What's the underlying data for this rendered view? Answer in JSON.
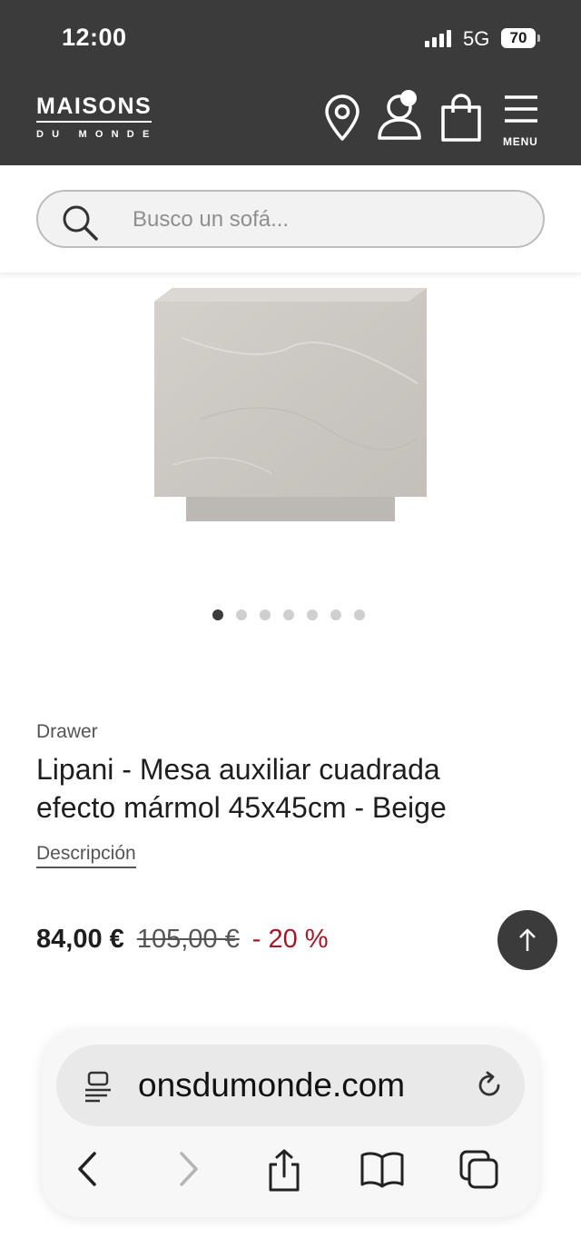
{
  "status_bar": {
    "time": "12:00",
    "network": "5G",
    "battery": "70"
  },
  "header": {
    "logo_main": "MAISONS",
    "logo_sub": "DU MONDE",
    "menu_label": "MENU",
    "bg_color": "#3b3b3b"
  },
  "search": {
    "placeholder": "Busco un sofá..."
  },
  "gallery": {
    "dot_count": 7,
    "active_index": 0
  },
  "product": {
    "brand": "Drawer",
    "title": "Lipani - Mesa auxiliar cuadrada efecto mármol 45x45cm - Beige",
    "description_link": "Descripción",
    "price_current": "84,00 €",
    "price_original": "105,00 €",
    "discount": "- 20 %",
    "discount_color": "#a5182a"
  },
  "browser": {
    "url": "onsdumonde.com"
  }
}
